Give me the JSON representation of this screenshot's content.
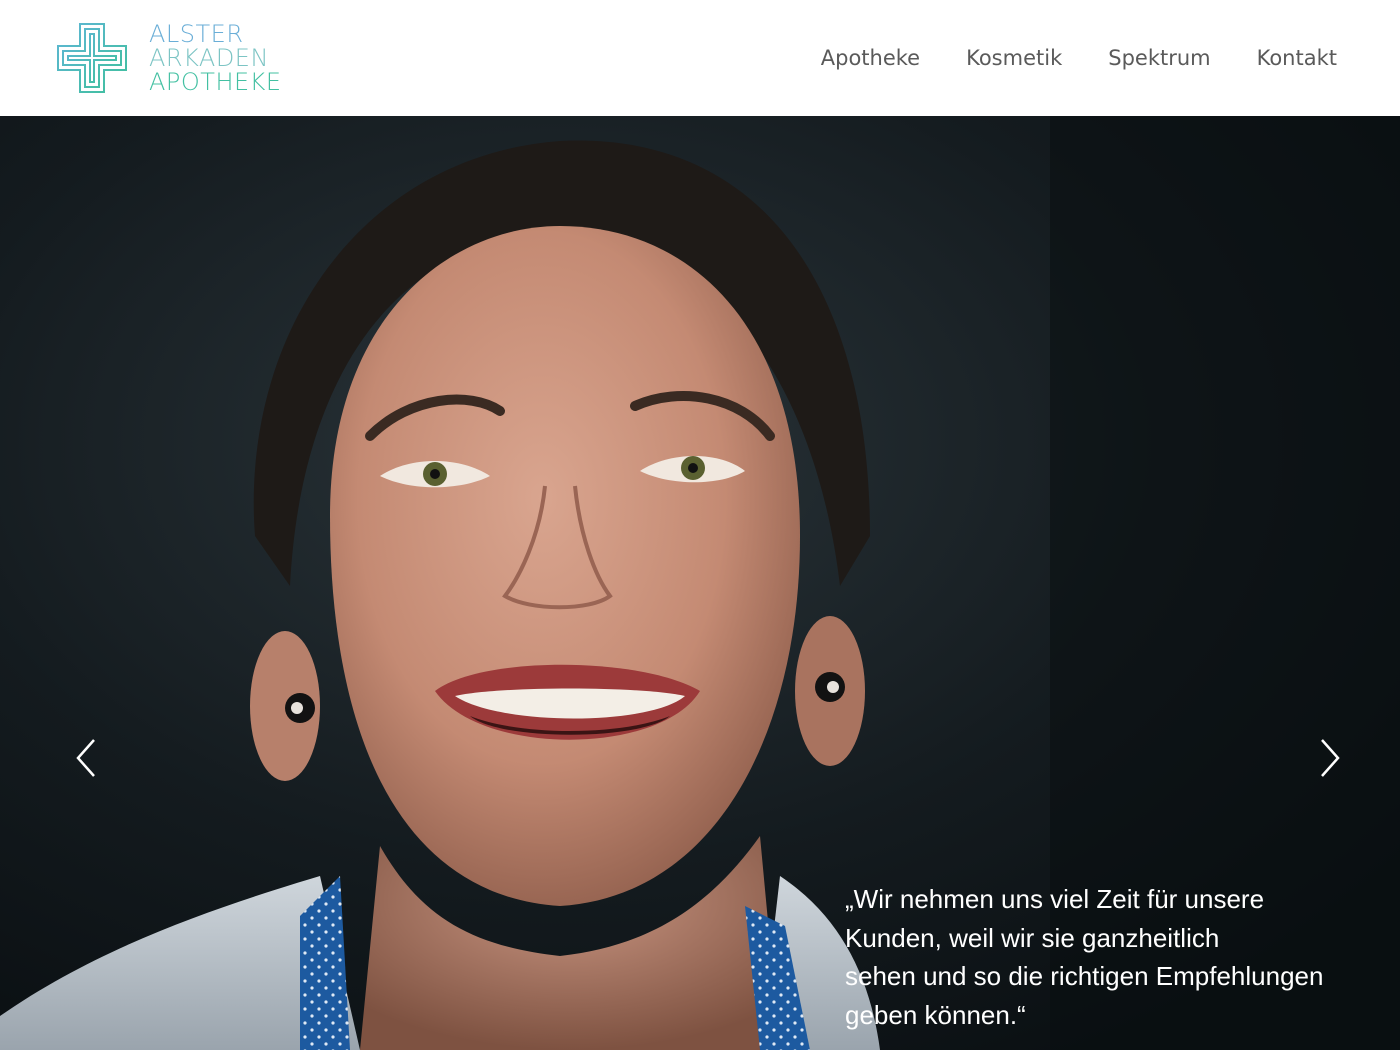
{
  "logo": {
    "line1": "ALSTER",
    "line2": "ARKADEN",
    "line3": "APOTHEKE",
    "icon": "pharmacy-cross-icon"
  },
  "nav": {
    "items": [
      {
        "label": "Apotheke"
      },
      {
        "label": "Kosmetik"
      },
      {
        "label": "Spektrum"
      },
      {
        "label": "Kontakt"
      }
    ]
  },
  "hero": {
    "quote_lines": [
      "„Wir nehmen uns viel Zeit für unsere",
      "Kunden, weil wir sie ganzheitlich",
      "sehen und so die richtigen Empfehlungen",
      "geben können.“"
    ],
    "prev_icon": "chevron-left-icon",
    "next_icon": "chevron-right-icon"
  },
  "colors": {
    "logo_blue": "#6aaed7",
    "logo_teal": "#43c0a2",
    "nav_text": "#5a5a5a",
    "hero_bg": "#0e1418"
  }
}
